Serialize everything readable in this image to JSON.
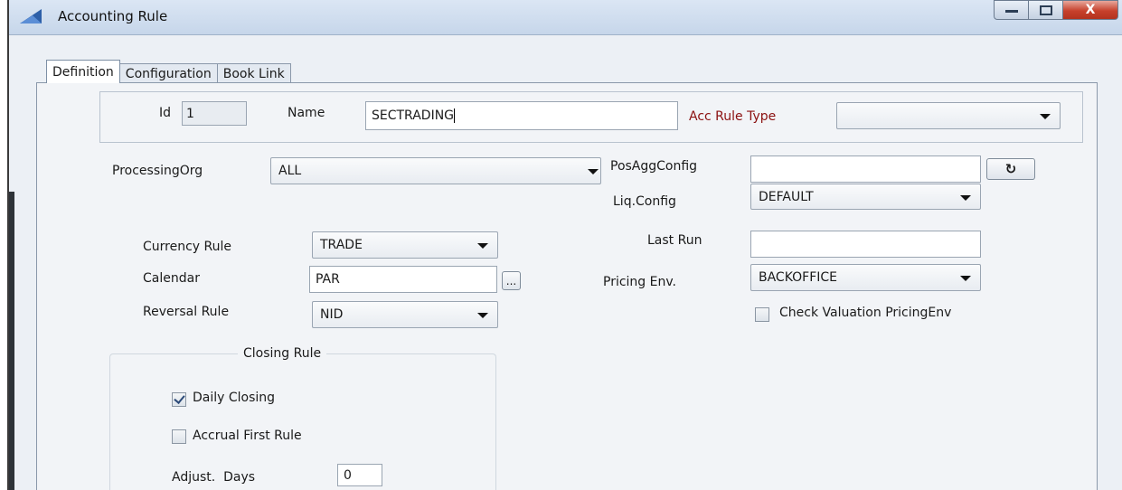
{
  "window": {
    "title": "Accounting Rule",
    "controls": {
      "minimize": "—",
      "maximize": "☐",
      "close": "X"
    }
  },
  "tabs": [
    {
      "label": "Definition",
      "active": true
    },
    {
      "label": "Configuration",
      "active": false
    },
    {
      "label": "Book Link",
      "active": false
    }
  ],
  "header_group": {
    "id_label": "Id",
    "id_value": "1",
    "name_label": "Name",
    "name_value": "SECTRADING",
    "type_label": "Acc Rule Type",
    "type_value": ""
  },
  "left": {
    "processing_org_label": "ProcessingOrg",
    "processing_org_value": "ALL",
    "currency_rule_label": "Currency Rule",
    "currency_rule_value": "TRADE",
    "calendar_label": "Calendar",
    "calendar_value": "PAR",
    "calendar_button": "...",
    "reversal_rule_label": "Reversal Rule",
    "reversal_rule_value": "NID"
  },
  "right": {
    "pos_agg_config_label": "PosAggConfig",
    "pos_agg_config_value": "",
    "refresh_icon": "refresh-icon",
    "refresh_glyph": "↻",
    "liq_config_label": "Liq.Config",
    "liq_config_value": "DEFAULT",
    "last_run_label": "Last Run",
    "last_run_value": "",
    "pricing_env_label": "Pricing Env.",
    "pricing_env_value": "BACKOFFICE",
    "check_valuation_label": "Check Valuation PricingEnv",
    "check_valuation_checked": false
  },
  "closing_rule": {
    "title": "Closing Rule",
    "daily_closing_label": "Daily Closing",
    "daily_closing_checked": true,
    "accrual_first_label": "Accrual First Rule",
    "accrual_first_checked": false,
    "adjust_days_label": "Adjust.  Days",
    "adjust_days_value": "0"
  },
  "colors": {
    "accent_red": "#8b1010",
    "titlebar": "#c6d6ea",
    "close_button": "#c7412c"
  }
}
